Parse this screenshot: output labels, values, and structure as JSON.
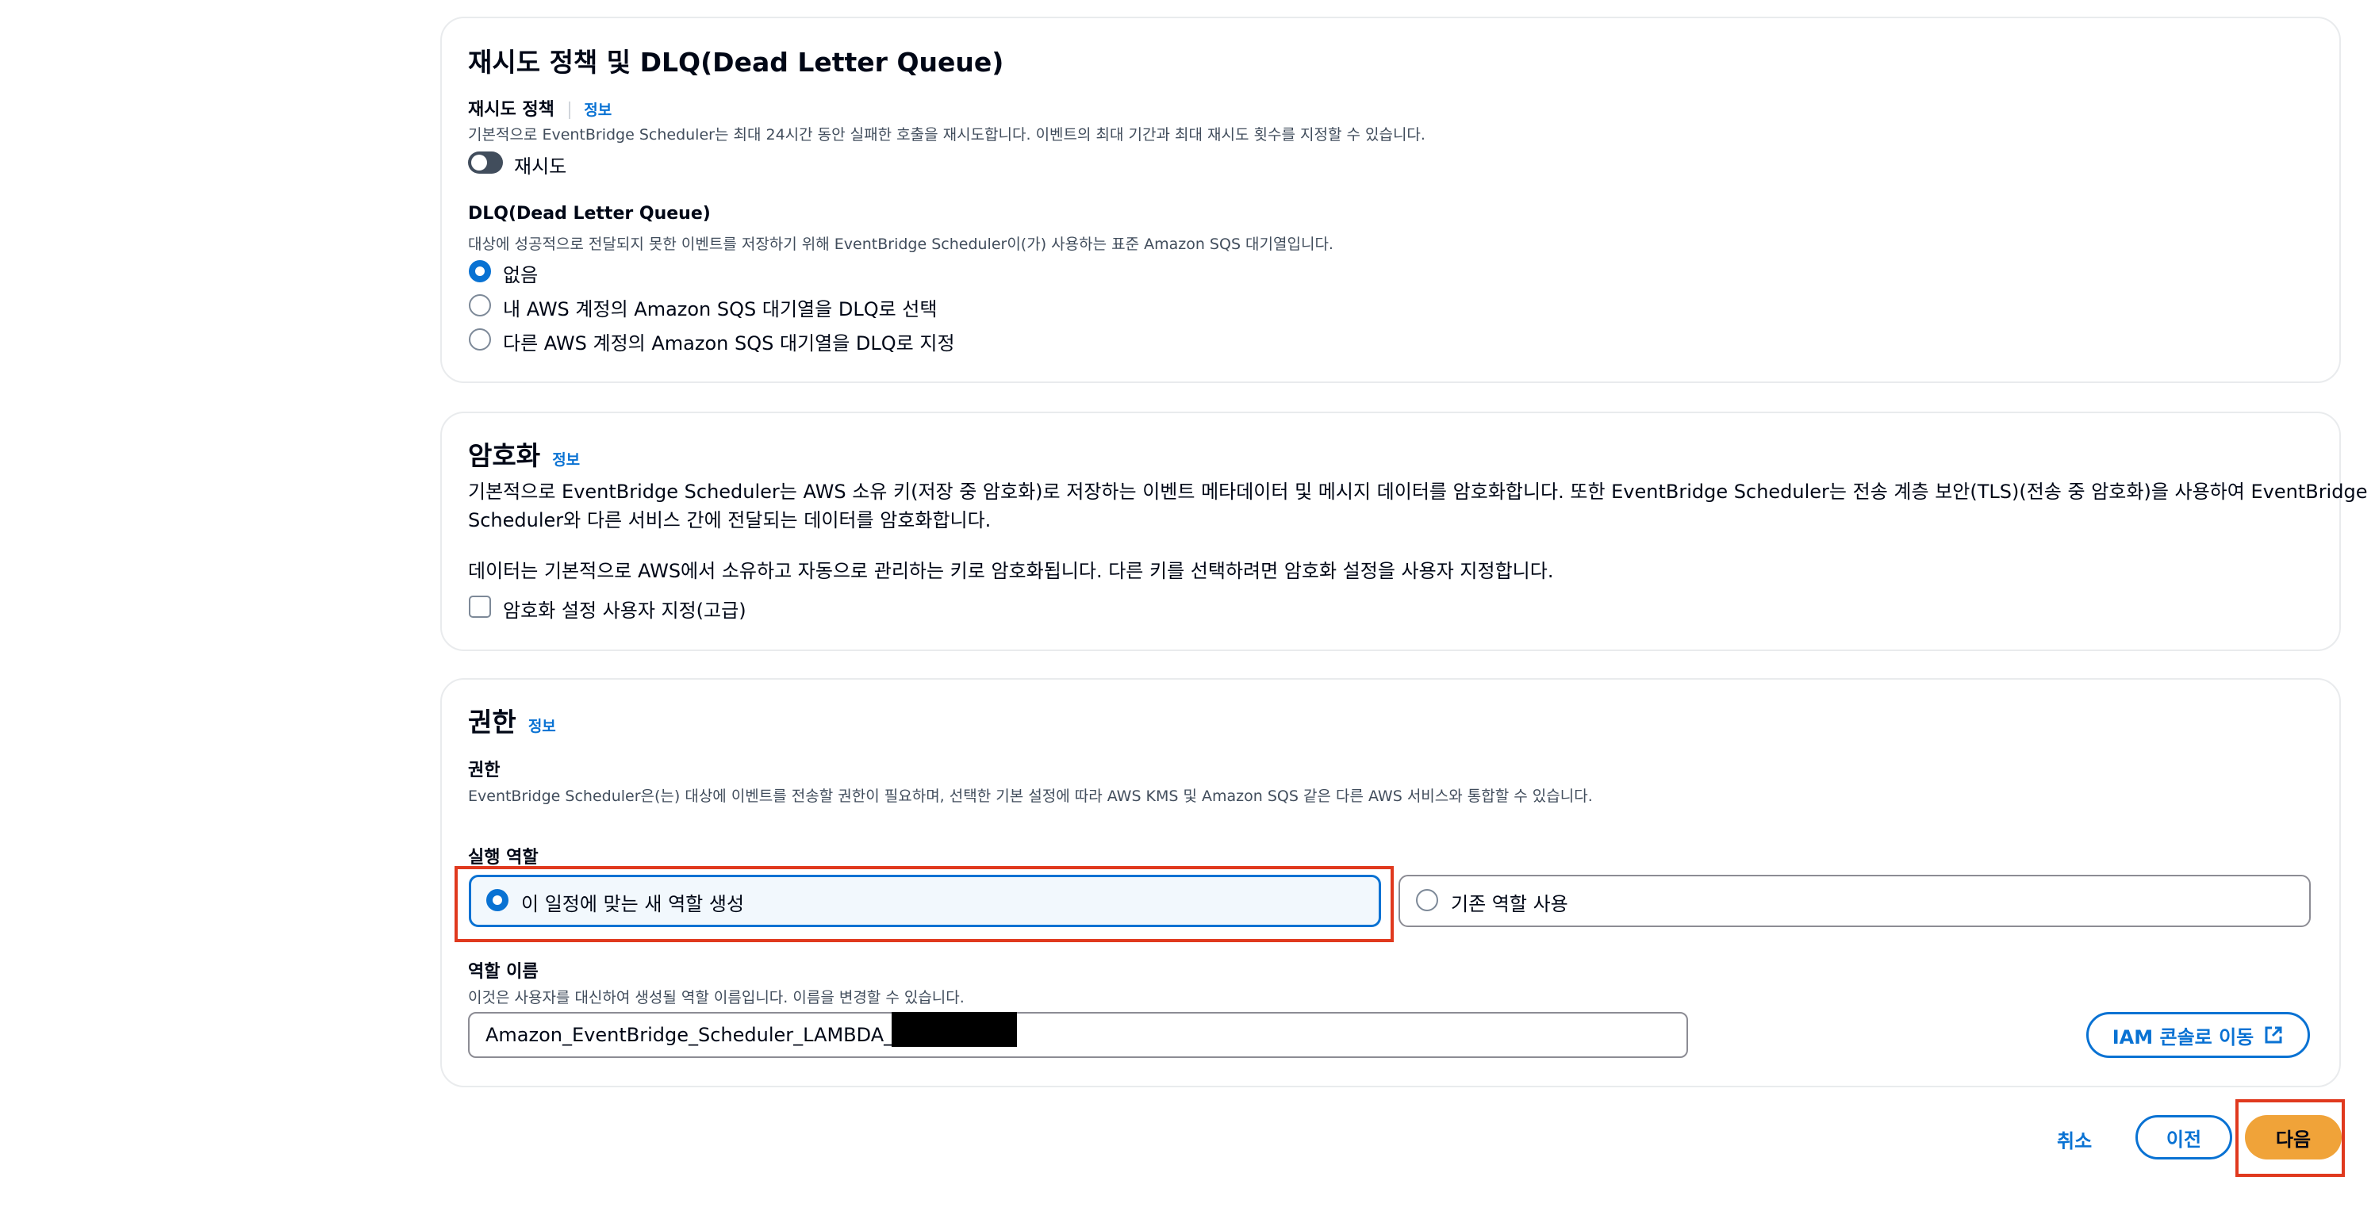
{
  "retry_section": {
    "title": "재시도 정책 및 DLQ(Dead Letter Queue)",
    "retry_policy_label": "재시도 정책",
    "info": "정보",
    "retry_policy_desc": "기본적으로 EventBridge Scheduler는 최대 24시간 동안 실패한 호출을 재시도합니다. 이벤트의 최대 기간과 최대 재시도 횟수를 지정할 수 있습니다.",
    "retry_toggle_label": "재시도",
    "dlq_label": "DLQ(Dead Letter Queue)",
    "dlq_desc": "대상에 성공적으로 전달되지 못한 이벤트를 저장하기 위해 EventBridge Scheduler이(가) 사용하는 표준 Amazon SQS 대기열입니다.",
    "dlq_options": [
      "없음",
      "내 AWS 계정의 Amazon SQS 대기열을 DLQ로 선택",
      "다른 AWS 계정의 Amazon SQS 대기열을 DLQ로 지정"
    ]
  },
  "encryption_section": {
    "title": "암호화",
    "info": "정보",
    "desc_line1": "기본적으로 EventBridge Scheduler는 AWS 소유 키(저장 중 암호화)로 저장하는 이벤트 메타데이터 및 메시지 데이터를 암호화합니다. 또한 EventBridge Scheduler는 전송 계층 보안(TLS)(전송 중 암호화)을 사용하여 EventBridge",
    "desc_line2": "Scheduler와 다른 서비스 간에 전달되는 데이터를 암호화합니다.",
    "desc2": "데이터는 기본적으로 AWS에서 소유하고 자동으로 관리하는 키로 암호화됩니다. 다른 키를 선택하려면 암호화 설정을 사용자 지정합니다.",
    "customize_label": "암호화 설정 사용자 지정(고급)"
  },
  "permissions_section": {
    "title": "권한",
    "info": "정보",
    "perm_label": "권한",
    "perm_desc": "EventBridge Scheduler은(는) 대상에 이벤트를 전송할 권한이 필요하며, 선택한 기본 설정에 따라 AWS KMS 및 Amazon SQS 같은 다른 AWS 서비스와 통합할 수 있습니다.",
    "exec_role_label": "실행 역할",
    "role_options": [
      "이 일정에 맞는 새 역할 생성",
      "기존 역할 사용"
    ],
    "role_name_label": "역할 이름",
    "role_name_desc": "이것은 사용자를 대신하여 생성될 역할 이름입니다. 이름을 변경할 수 있습니다.",
    "role_name_value": "Amazon_EventBridge_Scheduler_LAMBDA_0",
    "iam_button": "IAM 콘솔로 이동"
  },
  "footer": {
    "cancel": "취소",
    "previous": "이전",
    "next": "다음"
  },
  "colors": {
    "accent": "#0972d3",
    "primary_button": "#f0a339",
    "highlight_box": "#e0391e"
  }
}
